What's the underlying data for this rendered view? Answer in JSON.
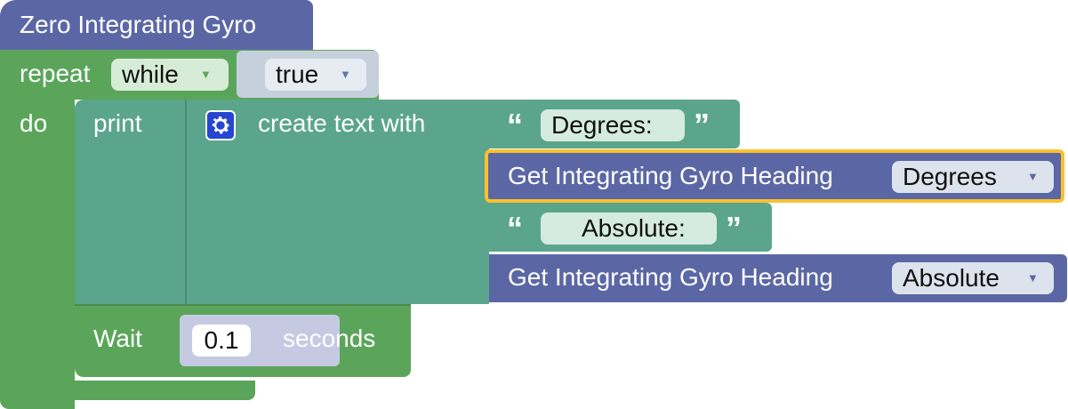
{
  "colors": {
    "event_block": "#5b67a5",
    "loop_block": "#5ba55b",
    "text_block": "#5ba58c",
    "sensor_block": "#5b67a5",
    "value_field": "#dde3ec",
    "selection_highlight": "#fbc02d",
    "mutator_icon": "#2546d1"
  },
  "event": {
    "title": "Zero Integrating Gyro"
  },
  "loop": {
    "repeat_label": "repeat",
    "mode": "while",
    "condition": "true",
    "do_label": "do"
  },
  "print_block": {
    "label": "print",
    "mutator_icon": "gear-icon",
    "create_text_label": "create text with",
    "items": [
      {
        "kind": "text",
        "value": "Degrees:"
      },
      {
        "kind": "sensor",
        "label": "Get Integrating Gyro Heading",
        "unit": "Degrees",
        "selected": true
      },
      {
        "kind": "text",
        "value": "Absolute:"
      },
      {
        "kind": "sensor",
        "label": "Get Integrating Gyro Heading",
        "unit": "Absolute",
        "selected": false
      }
    ]
  },
  "wait_block": {
    "label": "Wait",
    "value": "0.1",
    "unit": "seconds"
  },
  "glyphs": {
    "dropdown": "▼",
    "open_quote": "“",
    "close_quote": "”"
  }
}
